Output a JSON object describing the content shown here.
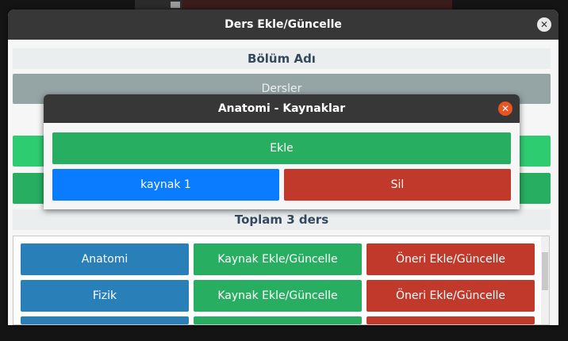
{
  "main_window": {
    "title": "Ders Ekle/Güncelle",
    "close_glyph": "✕",
    "section_label": "Bölüm Adı",
    "dersler_button": "Dersler",
    "total_label": "Toplam 3 ders",
    "courses": [
      {
        "name": "Anatomi",
        "kaynak_label": "Kaynak Ekle/Güncelle",
        "oneri_label": "Öneri Ekle/Güncelle"
      },
      {
        "name": "Fizik",
        "kaynak_label": "Kaynak Ekle/Güncelle",
        "oneri_label": "Öneri Ekle/Güncelle"
      }
    ]
  },
  "dialog": {
    "title": "Anatomi - Kaynaklar",
    "close_glyph": "✕",
    "ekle_label": "Ekle",
    "items": [
      {
        "name": "kaynak 1",
        "delete_label": "Sil"
      }
    ]
  },
  "colors": {
    "titlebar": "#373737",
    "green": "#27ae60",
    "blue": "#2980b9",
    "red": "#c0392b",
    "bright_blue": "#0a7cff",
    "close_orange": "#e95420"
  }
}
